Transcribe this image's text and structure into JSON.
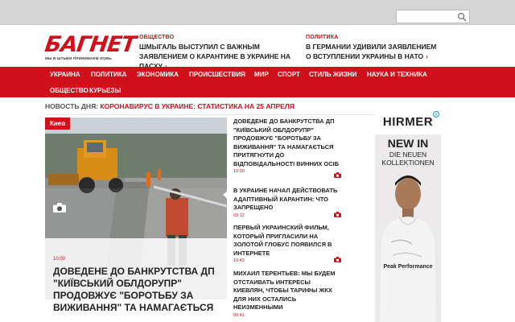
{
  "search": {
    "placeholder": ""
  },
  "logo": {
    "text": "БАГНЕТ",
    "tagline": "МЫ В ШТЫКИ ПРИНИМАЕМ ЛОЖЬ"
  },
  "header_news": [
    {
      "category": "Общество",
      "title": "Шмыгаль выступил с важным заявлением о карантине в Украине на Пасху"
    },
    {
      "category": "Политика",
      "title": "В Германии удивили заявлением о вступлении Украины в НАТО"
    }
  ],
  "nav": {
    "items": [
      "Украина",
      "Политика",
      "Экономика",
      "Происшествия",
      "Мир",
      "Спорт",
      "Стиль жизни",
      "Наука и техника",
      "Общество",
      "Курьезы"
    ]
  },
  "ticker": {
    "label": "Новость дня:",
    "text": "Коронавирус в Украине: статистика на 25 апреля"
  },
  "main_story": {
    "place": "Киев",
    "time": "10:00",
    "title": "Доведене до банкрутства ДП \"Київський облдорупр\" продовжує \"боротьбу за виживання\" та намагається"
  },
  "feed": [
    {
      "title": "Доведене до банкрутства ДП \"Київський облдорупр\" продовжує \"боротьбу за виживання\" та намагається притягнути до відповідальності винних осіб",
      "time": "10:00"
    },
    {
      "title": "В Украине начал действовать адаптивный карантин: что запрещено",
      "time": "03:12"
    },
    {
      "title": "Первый украинский фильм, который пригласили на Золотой глобус появился в интернете",
      "time": "16:43"
    },
    {
      "title": "Михаил Терентьев: Мы будем отстаивать интересы киевлян, чтобы тарифы ЖКХ для них остались неизменными",
      "time": "09:41"
    }
  ],
  "ad": {
    "brand": "HIRMER",
    "headline1": "NEW IN",
    "headline2": "DIE NEUEN KOLLEKTIONEN",
    "shirt_text": "Peak Performance"
  },
  "colors": {
    "brand_red": "#d0101b",
    "topbar": "#d6d6d6"
  }
}
